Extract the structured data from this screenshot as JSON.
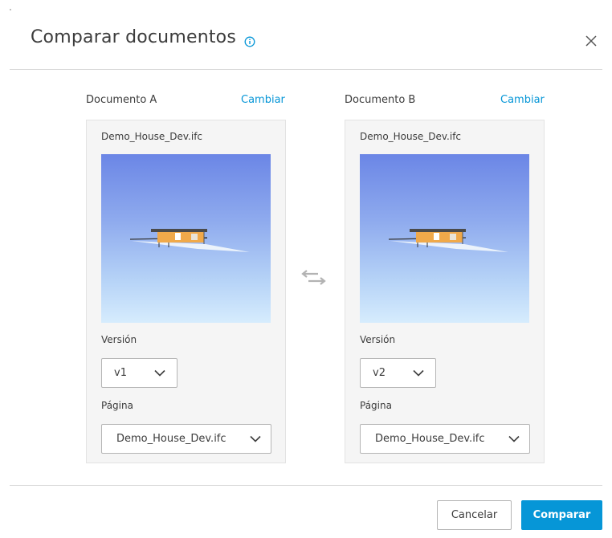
{
  "dialog": {
    "title": "Comparar documentos",
    "icons": {
      "info": "info-icon",
      "close": "close-icon",
      "swap": "swap-arrows-icon",
      "dropdown": "chevron-down-icon"
    }
  },
  "doc_a": {
    "header": "Documento A",
    "change_label": "Cambiar",
    "filename": "Demo_House_Dev.ifc",
    "version_label": "Versión",
    "version_value": "v1",
    "page_label": "Página",
    "page_value": "Demo_House_Dev.ifc"
  },
  "doc_b": {
    "header": "Documento B",
    "change_label": "Cambiar",
    "filename": "Demo_House_Dev.ifc",
    "version_label": "Versión",
    "version_value": "v2",
    "page_label": "Página",
    "page_value": "Demo_House_Dev.ifc"
  },
  "footer": {
    "cancel_label": "Cancelar",
    "compare_label": "Comparar"
  },
  "colors": {
    "accent": "#0696d7",
    "panel_bg": "#f5f5f5",
    "divider": "#d9d9d9"
  }
}
